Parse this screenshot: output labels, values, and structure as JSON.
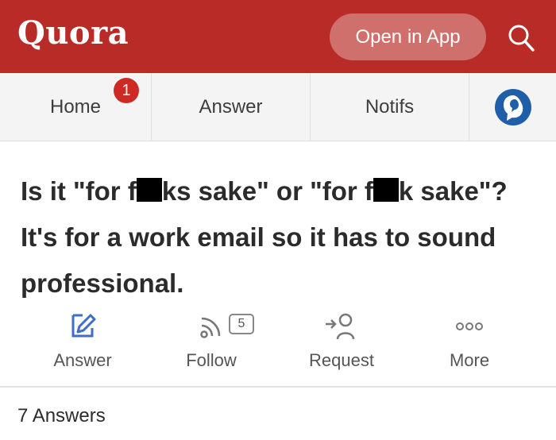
{
  "header": {
    "logo": "Quora",
    "open_app_label": "Open in App",
    "search_icon": "search-icon",
    "bg_color": "#b92b27"
  },
  "nav": {
    "home_label": "Home",
    "home_badge": "1",
    "answer_label": "Answer",
    "notifs_label": "Notifs",
    "profile_icon": "profile-avatar-icon"
  },
  "question": {
    "part1": "Is it \"for f",
    "part2": "ks sake\" or \"for f",
    "part3": "k sake\"? It's for a work email so it has to sound professional."
  },
  "actions": {
    "answer_label": "Answer",
    "follow_label": "Follow",
    "follow_count": "5",
    "request_label": "Request",
    "more_label": "More"
  },
  "footer": {
    "answers_count_label": "7 Answers"
  }
}
